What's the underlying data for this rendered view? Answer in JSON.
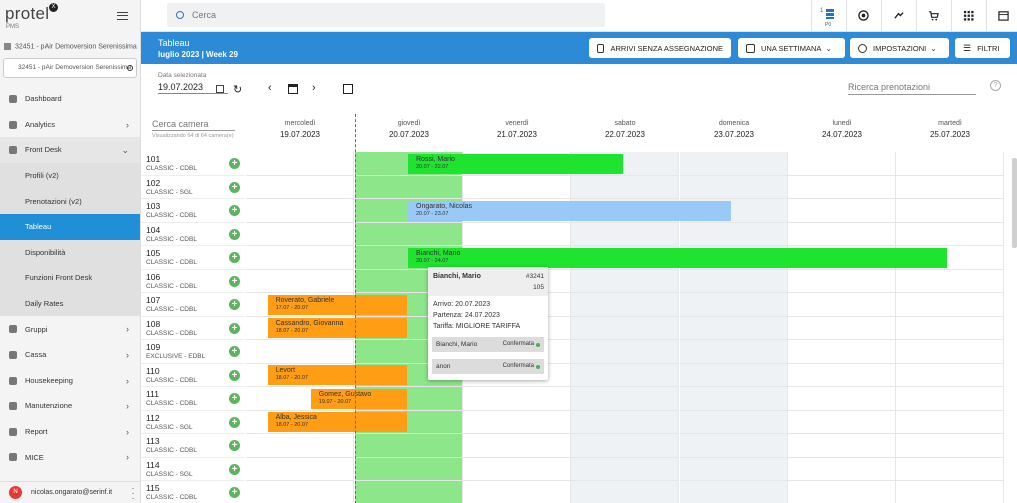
{
  "app": {
    "logo": "protel",
    "logo_badge": "X",
    "product": "PMS"
  },
  "property": {
    "line1": "32451 - pAir Demoversion Serenissima",
    "line2": "32451 - pAir Demoversion Serenissima"
  },
  "menu": [
    {
      "label": "Dashboard",
      "icon": "home-icon"
    },
    {
      "label": "Analytics",
      "icon": "chart-icon",
      "chev": "›"
    },
    {
      "label": "Front Desk",
      "icon": "desk-icon",
      "chev": "⌄"
    },
    {
      "label": "Profili (v2)",
      "sub": true
    },
    {
      "label": "Prenotazioni (v2)",
      "sub": true
    },
    {
      "label": "Tableau",
      "sub": true,
      "active": true
    },
    {
      "label": "Disponibilità",
      "sub": true
    },
    {
      "label": "Funzioni Front Desk",
      "sub": true
    },
    {
      "label": "Daily Rates",
      "sub": true
    },
    {
      "label": "Gruppi",
      "icon": "group-icon",
      "chev": "›"
    },
    {
      "label": "Cassa",
      "icon": "cash-icon",
      "chev": "›"
    },
    {
      "label": "Housekeeping",
      "icon": "broom-icon",
      "chev": "›"
    },
    {
      "label": "Manutenzione",
      "icon": "wrench-icon",
      "chev": "›"
    },
    {
      "label": "Report",
      "icon": "report-icon",
      "chev": "›"
    },
    {
      "label": "MICE",
      "icon": "mice-icon",
      "chev": "›"
    }
  ],
  "user": {
    "initial": "N",
    "email": "nicolas.ongarato@serinf.it"
  },
  "topbar": {
    "search_placeholder": "Cerca",
    "counter": "1",
    "counter_label": "P0"
  },
  "header": {
    "title": "Tableau",
    "subtitle": "luglio 2023 | Week 29",
    "buttons": {
      "arrivi": "ARRIVI SENZA ASSEGNAZIONE",
      "settimana": "UNA SETTIMANA",
      "impostazioni": "IMPOSTAZIONI",
      "filtri": "FILTRI"
    }
  },
  "controls": {
    "date_label": "Data selezionata",
    "date_value": "19.07.2023",
    "ricerca": "Ricerca prenotazioni",
    "help": "?"
  },
  "grid": {
    "cerca": "Cerca camera",
    "visualizzando": "Visualizzando 64 di 64 camera(e)",
    "days": [
      {
        "name": "mercoledì",
        "date": "19.07.2023"
      },
      {
        "name": "giovedì",
        "date": "20.07.2023"
      },
      {
        "name": "venerdì",
        "date": "21.07.2023"
      },
      {
        "name": "sabato",
        "date": "22.07.2023"
      },
      {
        "name": "domenica",
        "date": "23.07.2023"
      },
      {
        "name": "lunedì",
        "date": "24.07.2023"
      },
      {
        "name": "martedì",
        "date": "25.07.2023"
      }
    ],
    "rooms": [
      {
        "num": "101",
        "type": "CLASSIC - CDBL"
      },
      {
        "num": "102",
        "type": "CLASSIC - SGL"
      },
      {
        "num": "103",
        "type": "CLASSIC - CDBL"
      },
      {
        "num": "104",
        "type": "CLASSIC - CDBL"
      },
      {
        "num": "105",
        "type": "CLASSIC - CDBL"
      },
      {
        "num": "106",
        "type": "CLASSIC - CDBL"
      },
      {
        "num": "107",
        "type": "CLASSIC - CDBL"
      },
      {
        "num": "108",
        "type": "CLASSIC - CDBL"
      },
      {
        "num": "109",
        "type": "EXCLUSIVE - EDBL"
      },
      {
        "num": "110",
        "type": "CLASSIC - CDBL"
      },
      {
        "num": "111",
        "type": "CLASSIC - CDBL"
      },
      {
        "num": "112",
        "type": "CLASSIC - SGL"
      },
      {
        "num": "113",
        "type": "CLASSIC - CDBL"
      },
      {
        "num": "114",
        "type": "CLASSIC - SGL"
      },
      {
        "num": "115",
        "type": "CLASSIC - CDBL"
      }
    ],
    "bookings": [
      {
        "name": "Rossi, Mario",
        "dates": "20.07 - 22.07",
        "row": 0,
        "start": 1,
        "end": 3,
        "color": "#1ee32f"
      },
      {
        "name": "Ongarato, Nicolas",
        "dates": "20.07 - 23.07",
        "row": 2,
        "start": 1,
        "end": 4,
        "color": "#99c9f7"
      },
      {
        "name": "Bianchi, Mario",
        "dates": "20.07 - 24.07",
        "row": 4,
        "start": 1,
        "end": 6,
        "color": "#1ee32f"
      },
      {
        "name": "Roverato, Gabriele",
        "dates": "17.07 - 20.07",
        "row": 6,
        "start": -0.3,
        "end": 1,
        "color": "#ff9d14"
      },
      {
        "name": "Cassandro, Giovanna",
        "dates": "18.07 - 20.07",
        "row": 7,
        "start": -0.3,
        "end": 1,
        "color": "#ff9d14"
      },
      {
        "name": "Levort",
        "dates": "18.07 - 20.07",
        "row": 9,
        "start": -0.3,
        "end": 1,
        "color": "#ff9d14"
      },
      {
        "name": "Gomez, Gustavo",
        "dates": "19.07 - 20.07",
        "row": 10,
        "start": 0.1,
        "end": 1,
        "color": "#ff9d14"
      },
      {
        "name": "Alba, Jessica",
        "dates": "18.07 - 20.07",
        "row": 11,
        "start": -0.3,
        "end": 1,
        "color": "#ff9d14"
      }
    ]
  },
  "popup": {
    "name": "Bianchi, Mario",
    "id": "#3241",
    "room": "105",
    "arrivo": "Arrivo: 20.07.2023",
    "partenza": "Partenza: 24.07.2023",
    "tariffa": "Tariffa: MIGLIORE TARIFFA",
    "guests": [
      {
        "name": "Bianchi, Mario",
        "status": "Confermata"
      },
      {
        "name": "anon",
        "status": "Confermata"
      }
    ]
  }
}
